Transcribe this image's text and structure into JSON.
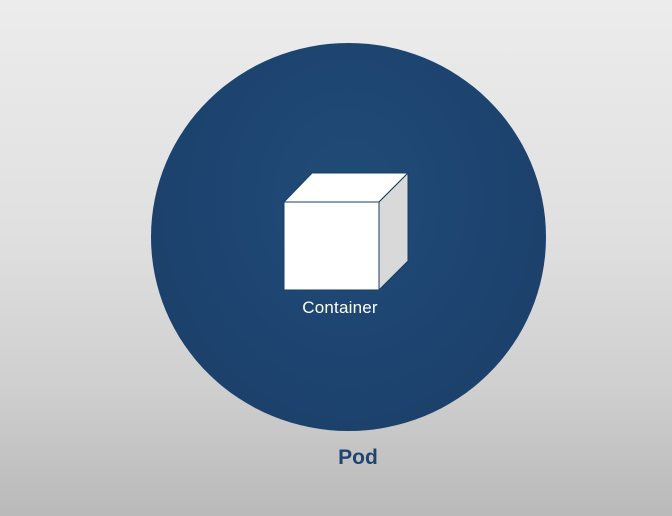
{
  "diagram": {
    "pod": {
      "label": "Pod",
      "color": "#1c436e",
      "label_color": "#1f4470"
    },
    "container": {
      "label": "Container",
      "icon": "cube-icon",
      "face_color": "#ffffff",
      "side_color": "#d9d9d9",
      "label_color": "#ffffff"
    },
    "background_color": "#e2e2e2"
  }
}
